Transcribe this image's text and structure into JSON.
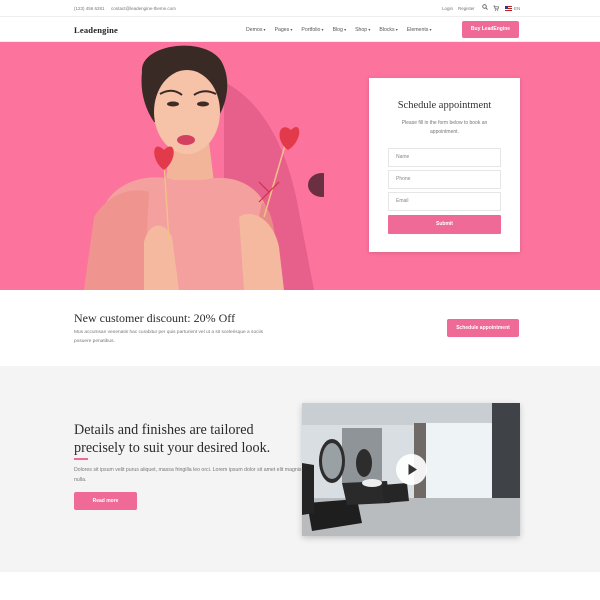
{
  "topbar": {
    "phone": "(123) 456 6281",
    "email": "contact@leadengine-theme.com",
    "login": "Login",
    "register": "Register",
    "language": "EN"
  },
  "header": {
    "logo": "Leadengine",
    "nav": [
      "Demos",
      "Pages",
      "Portfolio",
      "Blog",
      "Shop",
      "Blocks",
      "Elements"
    ],
    "buy_label": "Buy LeadEngine"
  },
  "colors": {
    "accent": "#f06a97",
    "hero_bg": "#fc739e",
    "section_bg": "#f4f4f4"
  },
  "appointment": {
    "title": "Schedule appointment",
    "subtitle": "Please fill in the form below to book an appointment.",
    "name_placeholder": "Name",
    "phone_placeholder": "Phone",
    "email_placeholder": "Email",
    "submit_label": "Submit"
  },
  "discount": {
    "title": "New customer discount: 20% Off",
    "text": "Mus accumsan venenatis hac curabitur per quis parturient vel ut a sit scelerisque a sociis posuere penatibus.",
    "button_label": "Schedule appointment"
  },
  "feature": {
    "title": "Details and finishes are tailored precisely to suit your desired look.",
    "text": "Dolores sit ipsum velit purus aliquet, massa fringilla leo orci. Lorem ipsum dolor sit amet elit magnis nulla.",
    "button_label": "Read more",
    "video_icon": "play-icon"
  },
  "icons": {
    "search": "search-icon",
    "cart": "cart-icon",
    "flag": "us-flag-icon"
  }
}
